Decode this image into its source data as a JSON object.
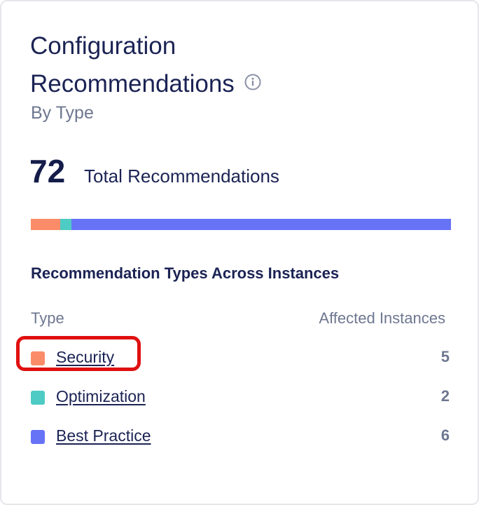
{
  "card": {
    "title_line1": "Configuration",
    "title_line2": "Recommendations",
    "subtitle": "By Type",
    "info_icon": "info-circle-icon"
  },
  "summary": {
    "total": "72",
    "total_label": "Total Recommendations"
  },
  "distribution": [
    {
      "type": "Security",
      "count": 5,
      "color": "#fb8c69"
    },
    {
      "type": "Optimization",
      "count": 2,
      "color": "#4ecbc4"
    },
    {
      "type": "Best Practice",
      "count": 65,
      "color": "#6673f6"
    }
  ],
  "section": {
    "heading": "Recommendation Types Across Instances",
    "col_type": "Type",
    "col_affected": "Affected Instances"
  },
  "types": [
    {
      "label": "Security",
      "count": "5",
      "color": "#fb8c69"
    },
    {
      "label": "Optimization",
      "count": "2",
      "color": "#4ecbc4"
    },
    {
      "label": "Best Practice",
      "count": "6",
      "color": "#6673f6"
    }
  ],
  "annotation": {
    "highlight_color": "#e01010"
  }
}
